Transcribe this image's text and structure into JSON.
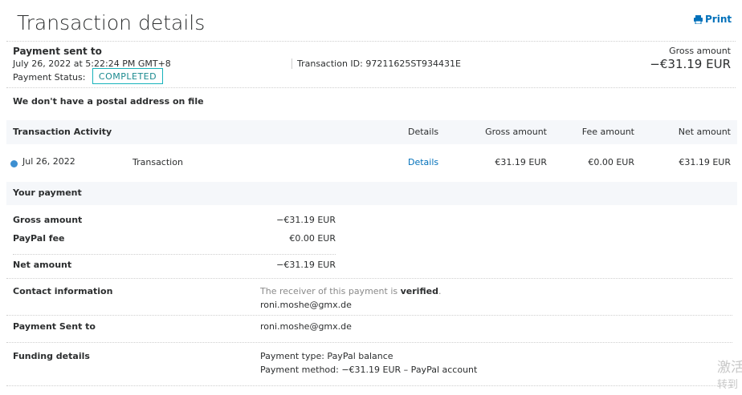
{
  "page": {
    "title": "Transaction details",
    "print_label": "Print"
  },
  "header": {
    "payment_sent_to_label": "Payment sent to",
    "date": "July 26, 2022 at 5:22:24 PM GMT+8",
    "status_label": "Payment Status:",
    "status_value": "COMPLETED",
    "transaction_id": "Transaction ID: 97211625ST934431E",
    "gross_label": "Gross amount",
    "gross_value": "−€31.19 EUR"
  },
  "postal_note": "We don't have a postal address on file",
  "activity": {
    "headers": {
      "title": "Transaction Activity",
      "details": "Details",
      "gross": "Gross amount",
      "fee": "Fee amount",
      "net": "Net amount"
    },
    "row": {
      "date": "Jul 26, 2022",
      "type": "Transaction",
      "details_link": "Details",
      "gross": "€31.19 EUR",
      "fee": "€0.00 EUR",
      "net": "€31.19 EUR"
    }
  },
  "your_payment": {
    "title": "Your payment",
    "gross_label": "Gross amount",
    "gross_value": "−€31.19 EUR",
    "fee_label": "PayPal fee",
    "fee_value": "€0.00 EUR",
    "net_label": "Net amount",
    "net_value": "−€31.19 EUR"
  },
  "contact": {
    "label": "Contact information",
    "verified_prefix": "The receiver of this payment is ",
    "verified_word": "verified",
    "verified_suffix": ".",
    "email": "roni.moshe@gmx.de"
  },
  "sent_to": {
    "label": "Payment Sent to",
    "email": "roni.moshe@gmx.de"
  },
  "funding": {
    "label": "Funding details",
    "type": "Payment type: PayPal balance",
    "method": "Payment method: −€31.19 EUR – PayPal account"
  },
  "watermark": {
    "line1": "激活",
    "line2": "转到"
  },
  "colors": {
    "accent": "#0070ba",
    "status_border": "#17b3bb",
    "dot": "#3d8fd1"
  },
  "icons": {
    "print": "printer-icon",
    "status_dot": "blue-dot"
  }
}
